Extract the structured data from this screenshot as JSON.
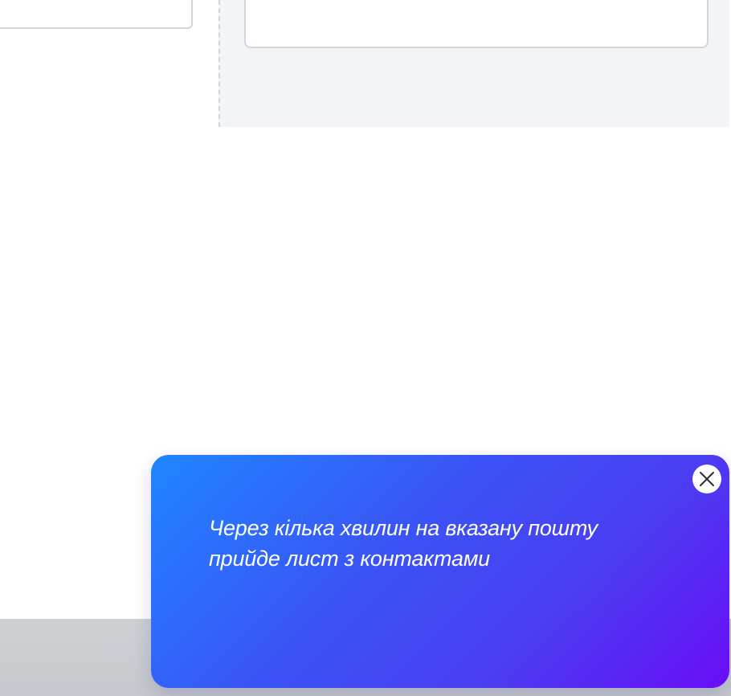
{
  "toast": {
    "message": "Через кілька хвилин на вказану пошту прийде лист з контактами",
    "close_icon": "close-icon"
  },
  "colors": {
    "toast_gradient_start": "#1f86ff",
    "toast_gradient_end": "#6a0cf6",
    "panel_background": "#f3f4f7",
    "footer_band": "#cdd0d4"
  }
}
